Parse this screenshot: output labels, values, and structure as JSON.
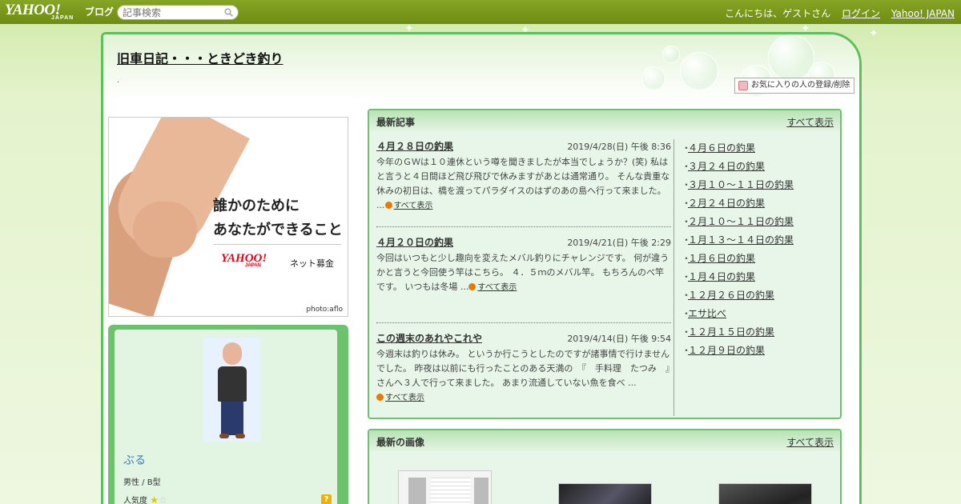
{
  "header": {
    "logo_main": "YAHOO!",
    "logo_sub": "JAPAN",
    "logo_blog": "ブログ",
    "search_placeholder": "記事検索",
    "greeting": "こんにちは、ゲストさん",
    "login": "ログイン",
    "yahoo_japan": "Yahoo! JAPAN"
  },
  "blog": {
    "title": "旧車日記・・・ときどき釣り",
    "description": ".",
    "fav_button": "お気に入りの人の登録/削除"
  },
  "ad": {
    "line1": "誰かのために",
    "line2": "あなたができること",
    "logo": "YAHOO!",
    "logo_sub": "JAPAN",
    "service": "ネット募金",
    "credit": "photo:aflo"
  },
  "profile": {
    "nickname": "ぶる",
    "info": "男性 / B型",
    "popularity_label": "人気度",
    "popularity_stars": 1,
    "popularity_max": 2,
    "help": "?"
  },
  "latest": {
    "title": "最新記事",
    "show_all": "すべて表示",
    "articles": [
      {
        "title": "４月２８日の釣果",
        "date": "2019/4/28(日) 午後 8:36",
        "body": "今年のＧＷは１０連休という噂を聞きましたが本当でしょうか？(笑) 私はと言うと４日間ほど飛び飛びで休みますがあとは通常通り。 そんな貴重な休みの初日は、橋を渡ってパラダイスのはずのあの島へ行って来ました。 ...",
        "more": "すべて表示"
      },
      {
        "title": "４月２０日の釣果",
        "date": "2019/4/21(日) 午後 2:29",
        "body": "今回はいつもと少し趣向を変えたメバル釣りにチャレンジです。 何が違うかと言うと今回使う竿はこちら。 ４．５ｍのメバル竿。 もちろんのべ竿です。 いつもは冬場 ...",
        "more": "すべて表示"
      },
      {
        "title": "この週末のあれやこれや",
        "date": "2019/4/14(日) 午後 9:54",
        "body": "今週末は釣りは休み。 というか行こうとしたのですが諸事情で行けませんでした。 昨夜は以前にも行ったことのある天満の　『　手料理　たつみ　』　さんへ３人で行って来ました。 あまり流通していない魚を食べ ...",
        "more": "すべて表示"
      }
    ],
    "side_list": [
      "４月６日の釣果",
      "３月２４日の釣果",
      "３月１０～１１日の釣果",
      "２月２４日の釣果",
      "２月１０～１１日の釣果",
      "１月１３～１４日の釣果",
      "１月６日の釣果",
      "１月４日の釣果",
      "１２月２６日の釣果",
      "エサ比べ",
      "１２月１５日の釣果",
      "１２月９日の釣果"
    ]
  },
  "images": {
    "title": "最新の画像",
    "show_all": "すべて表示"
  }
}
